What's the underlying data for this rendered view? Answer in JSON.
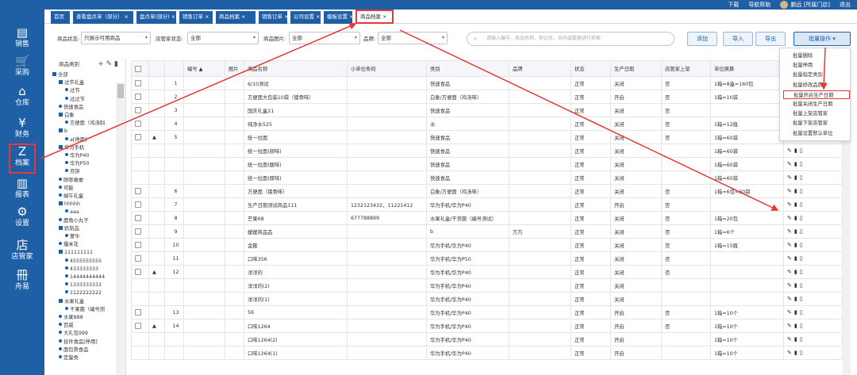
{
  "app": {
    "logo": "&"
  },
  "topbar": {
    "download": "下载",
    "guide": "导航帮助",
    "user": "鹏远 [所属门店]",
    "logout": "退出"
  },
  "sidebar": {
    "items": [
      {
        "label": "销售",
        "icon": "sales-icon"
      },
      {
        "label": "采购",
        "icon": "cart-icon"
      },
      {
        "label": "仓库",
        "icon": "warehouse-icon"
      },
      {
        "label": "财务",
        "icon": "finance-icon"
      },
      {
        "label": "档案",
        "icon": "archive-icon"
      },
      {
        "label": "报表",
        "icon": "report-icon"
      },
      {
        "label": "设置",
        "icon": "gear-icon"
      },
      {
        "label": "店管家",
        "icon": "store-icon"
      },
      {
        "label": "舟易",
        "icon": "zhouyi-icon"
      }
    ]
  },
  "tabs": [
    {
      "label": "首页"
    },
    {
      "label": "查看盘点单（部分）"
    },
    {
      "label": "盘点单(部分)"
    },
    {
      "label": "销售订单"
    },
    {
      "label": "商品档案"
    },
    {
      "label": "销售订单"
    },
    {
      "label": "公司设置"
    },
    {
      "label": "模板设置"
    },
    {
      "label": "商品档案"
    }
  ],
  "filters": {
    "status_label": "商品状态:",
    "status_value": "只展示可用商品",
    "store_status_label": "店管家状态:",
    "store_status_value": "全部",
    "image_label": "商品图片:",
    "image_value": "全部",
    "brand_label": "品牌:",
    "brand_value": "全部",
    "search_placeholder": "请输入编号、商品名称、助记名、条码或数据进行检索"
  },
  "buttons": {
    "add": "添加",
    "import": "导入",
    "export": "导出",
    "batch": "批量操作"
  },
  "category": {
    "title": "商品类别",
    "nodes": [
      {
        "label": "全部",
        "kind": "sq",
        "indent": 0
      },
      {
        "label": "过节礼盒",
        "kind": "sq",
        "indent": 1
      },
      {
        "label": "过节",
        "kind": "dot",
        "indent": 2
      },
      {
        "label": "过过节",
        "kind": "dot",
        "indent": 2
      },
      {
        "label": "快速食品",
        "kind": "dot",
        "indent": 1
      },
      {
        "label": "白象",
        "kind": "sq",
        "indent": 1
      },
      {
        "label": "方便面（鸡汤制",
        "kind": "dot",
        "indent": 2
      },
      {
        "label": "b",
        "kind": "sq",
        "indent": 1
      },
      {
        "label": "a[停用]",
        "kind": "dot",
        "indent": 2
      },
      {
        "label": "华为手机",
        "kind": "sq",
        "indent": 1
      },
      {
        "label": "华为P40",
        "kind": "dot",
        "indent": 2
      },
      {
        "label": "华为P50",
        "kind": "dot",
        "indent": 2
      },
      {
        "label": "月饼",
        "kind": "dot",
        "indent": 2
      },
      {
        "label": "哆哆敢敢",
        "kind": "dot",
        "indent": 1
      },
      {
        "label": "可能",
        "kind": "dot",
        "indent": 1
      },
      {
        "label": "端午礼盒",
        "kind": "dot",
        "indent": 1
      },
      {
        "label": "hhhhh",
        "kind": "sq",
        "indent": 1
      },
      {
        "label": "aaa",
        "kind": "dot",
        "indent": 2
      },
      {
        "label": "鹿角小丸子",
        "kind": "dot",
        "indent": 1
      },
      {
        "label": "奶制品",
        "kind": "sq",
        "indent": 1
      },
      {
        "label": "蒙牛",
        "kind": "dot",
        "indent": 2
      },
      {
        "label": "爆米花",
        "kind": "dot",
        "indent": 1
      },
      {
        "label": "111111111",
        "kind": "sq",
        "indent": 1
      },
      {
        "label": "4555555555",
        "kind": "dot",
        "indent": 2
      },
      {
        "label": "433333333",
        "kind": "dot",
        "indent": 2
      },
      {
        "label": "14444444444",
        "kind": "dot",
        "indent": 2
      },
      {
        "label": "1333333333",
        "kind": "dot",
        "indent": 2
      },
      {
        "label": "1122222222",
        "kind": "dot",
        "indent": 2
      },
      {
        "label": "水果礼盒",
        "kind": "sq",
        "indent": 1
      },
      {
        "label": "干果菌（编号测",
        "kind": "dot",
        "indent": 2
      },
      {
        "label": "水果888",
        "kind": "dot",
        "indent": 1
      },
      {
        "label": "百威",
        "kind": "dot",
        "indent": 1
      },
      {
        "label": "大礼包999",
        "kind": "dot",
        "indent": 1
      },
      {
        "label": "挂件食品[停用]",
        "kind": "dot",
        "indent": 1
      },
      {
        "label": "面包熟食品",
        "kind": "dot",
        "indent": 1
      },
      {
        "label": "定量类",
        "kind": "dot",
        "indent": 1
      }
    ]
  },
  "table": {
    "headers": [
      "",
      "",
      "",
      "编号",
      "图片",
      "商品名称",
      "小单位条码",
      "类别",
      "品牌",
      "状态",
      "生产日期",
      "店管家上架",
      "单位换算",
      "操"
    ],
    "rows": [
      {
        "cb": true,
        "exp": "",
        "no": "1",
        "name": "6/10测试",
        "barcode": "",
        "cat": "快速食品",
        "brand": "",
        "status": "正常",
        "prod": "关闭",
        "store": "否",
        "unit": "1箱=8盒=160包"
      },
      {
        "cb": true,
        "exp": "",
        "no": "2",
        "name": "方便面大包装10袋（猪骨味）",
        "barcode": "",
        "cat": "白象/方便面（鸡汤味）",
        "brand": "",
        "status": "正常",
        "prod": "开启",
        "store": "否",
        "unit": "1箱=10袋"
      },
      {
        "cb": true,
        "exp": "",
        "no": "3",
        "name": "国庆礼盒21",
        "barcode": "",
        "cat": "快速食品",
        "brand": "",
        "status": "正常",
        "prod": "关闭",
        "store": "否",
        "unit": ""
      },
      {
        "cb": true,
        "exp": "",
        "no": "4",
        "name": "纯净水525",
        "barcode": "",
        "cat": "水",
        "brand": "",
        "status": "正常",
        "prod": "关闭",
        "store": "否",
        "unit": "1箱=12瓶"
      },
      {
        "cb": true,
        "exp": "▲",
        "no": "5",
        "name": "统一拉面",
        "barcode": "",
        "cat": "快速食品",
        "brand": "",
        "status": "正常",
        "prod": "关闭",
        "store": "否",
        "unit": "1箱=60袋"
      },
      {
        "cb": false,
        "exp": "",
        "no": "",
        "name": "统一拉面(卵味)",
        "barcode": "",
        "cat": "快速食品",
        "brand": "",
        "status": "正常",
        "prod": "关闭",
        "store": "",
        "unit": "1箱=60袋"
      },
      {
        "cb": false,
        "exp": "",
        "no": "",
        "name": "统一拉面(酸味)",
        "barcode": "",
        "cat": "快速食品",
        "brand": "",
        "status": "正常",
        "prod": "关闭",
        "store": "",
        "unit": "1箱=60袋"
      },
      {
        "cb": false,
        "exp": "",
        "no": "",
        "name": "统一拉面(原味)",
        "barcode": "",
        "cat": "快速食品",
        "brand": "",
        "status": "正常",
        "prod": "关闭",
        "store": "",
        "unit": "1箱=60袋"
      },
      {
        "cb": true,
        "exp": "",
        "no": "6",
        "name": "方便面（猪骨味）",
        "barcode": "",
        "cat": "白象/方便面（鸡汤味）",
        "brand": "",
        "status": "正常",
        "prod": "关闭",
        "store": "否",
        "unit": "1箱=6包=30袋"
      },
      {
        "cb": true,
        "exp": "",
        "no": "7",
        "name": "生产日期测试商品111",
        "barcode": "1232123432、11221412",
        "cat": "华为手机/华为P40",
        "brand": "",
        "status": "正常",
        "prod": "开启",
        "store": "否",
        "unit": ""
      },
      {
        "cb": true,
        "exp": "",
        "no": "8",
        "name": "芒果68",
        "barcode": "677788899",
        "cat": "水果礼盒/干货菌（编号测试）",
        "brand": "",
        "status": "正常",
        "prod": "关闭",
        "store": "否",
        "unit": "1箱=20包"
      },
      {
        "cb": true,
        "exp": "",
        "no": "9",
        "name": "嫒嫒商品品",
        "barcode": "",
        "cat": "b",
        "brand": "万万",
        "status": "正常",
        "prod": "关闭",
        "store": "否",
        "unit": "1箱=6个"
      },
      {
        "cb": true,
        "exp": "",
        "no": "10",
        "name": "金箍",
        "barcode": "",
        "cat": "华为手机/华为P40",
        "brand": "",
        "status": "正常",
        "prod": "关闭",
        "store": "否",
        "unit": "1箱=15瓶"
      },
      {
        "cb": true,
        "exp": "",
        "no": "11",
        "name": "口味356",
        "barcode": "",
        "cat": "华为手机/华为P50",
        "brand": "",
        "status": "正常",
        "prod": "关闭",
        "store": "否",
        "unit": ""
      },
      {
        "cb": true,
        "exp": "▲",
        "no": "12",
        "name": "洋洋的",
        "barcode": "",
        "cat": "华为手机/华为P40",
        "brand": "",
        "status": "正常",
        "prod": "关闭",
        "store": "否",
        "unit": ""
      },
      {
        "cb": false,
        "exp": "",
        "no": "",
        "name": "洋洋的(2)",
        "barcode": "",
        "cat": "华为手机/华为P40",
        "brand": "",
        "status": "正常",
        "prod": "关闭",
        "store": "",
        "unit": ""
      },
      {
        "cb": false,
        "exp": "",
        "no": "",
        "name": "洋洋的(1)",
        "barcode": "",
        "cat": "华为手机/华为P40",
        "brand": "",
        "status": "正常",
        "prod": "关闭",
        "store": "",
        "unit": ""
      },
      {
        "cb": true,
        "exp": "",
        "no": "13",
        "name": "56",
        "barcode": "",
        "cat": "华为手机/华为P40",
        "brand": "",
        "status": "正常",
        "prod": "开启",
        "store": "否",
        "unit": "1箱=10个"
      },
      {
        "cb": true,
        "exp": "▲",
        "no": "14",
        "name": "口味1264",
        "barcode": "",
        "cat": "华为手机/华为P40",
        "brand": "",
        "status": "正常",
        "prod": "开启",
        "store": "否",
        "unit": "1箱=10个"
      },
      {
        "cb": false,
        "exp": "",
        "no": "",
        "name": "口味1264(2)",
        "barcode": "",
        "cat": "华为手机/华为P40",
        "brand": "",
        "status": "正常",
        "prod": "开启",
        "store": "",
        "unit": "1箱=10个"
      },
      {
        "cb": false,
        "exp": "",
        "no": "",
        "name": "口味1264(1)",
        "barcode": "",
        "cat": "华为手机/华为P40",
        "brand": "",
        "status": "正常",
        "prod": "开启",
        "store": "",
        "unit": "1箱=10个"
      }
    ]
  },
  "batch_menu": [
    "批量删除",
    "批量停用",
    "批量指定类别",
    "批量修改品牌",
    "批量开启生产日期",
    "批量关闭生产日期",
    "批量上架店管家",
    "批量下架店管家",
    "批量设置默认单位"
  ],
  "batch_menu_highlight": 4,
  "colors": {
    "primary": "#1f5fa6",
    "annotation": "#e53935"
  }
}
